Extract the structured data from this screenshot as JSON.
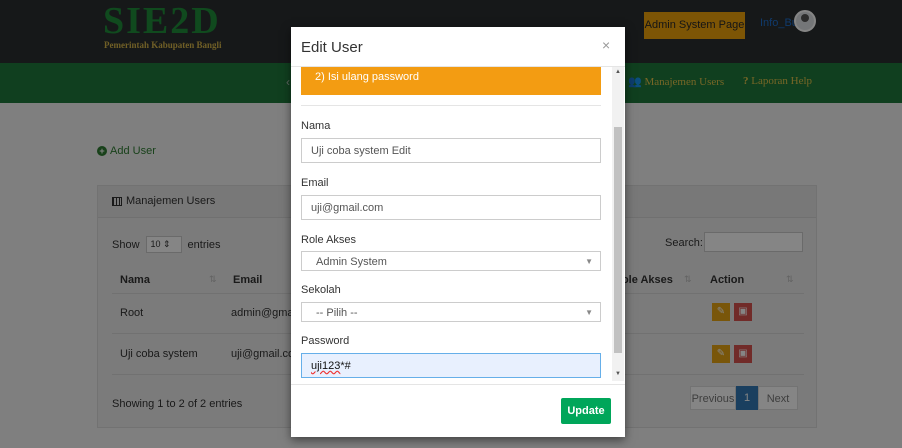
{
  "header": {
    "logo_title": "SIE2D",
    "logo_subtitle": "Pemerintah Kabupaten Bangli",
    "admin_button": "Admin System Page",
    "user_name": "Info_Bu"
  },
  "nav": {
    "items": [
      {
        "label": "Manajemen Users"
      },
      {
        "label": "Laporan Help"
      }
    ]
  },
  "page": {
    "add_user": "Add User",
    "panel_title": "Manajemen Users",
    "show": "Show",
    "entries": "entries",
    "page_length": "10",
    "search_label": "Search:",
    "columns": [
      "Nama",
      "Email",
      "Role Akses",
      "Action"
    ],
    "rows": [
      {
        "nama": "Root",
        "email": "admin@gma"
      },
      {
        "nama": "Uji coba system",
        "email": "uji@gmail.co"
      }
    ],
    "info": "Showing 1 to 2 of 2 entries",
    "pagination": {
      "prev": "Previous",
      "current": "1",
      "next": "Next"
    }
  },
  "modal": {
    "title": "Edit User",
    "close": "×",
    "notice": "2) Isi ulang password",
    "fields": {
      "nama_label": "Nama",
      "nama_value": "Uji coba system Edit",
      "email_label": "Email",
      "email_value": "uji@gmail.com",
      "role_label": "Role Akses",
      "role_value": "Admin System",
      "sekolah_label": "Sekolah",
      "sekolah_value": "-- Pilih --",
      "password_label": "Password",
      "password_value_spell": "uji123",
      "password_value_rest": "*#"
    },
    "update_button": "Update"
  },
  "colors": {
    "topbar": "#2b2f30",
    "navbar": "#1f7a3c",
    "warning": "#f39c12",
    "success": "#00a65a",
    "primary": "#337ab7"
  }
}
